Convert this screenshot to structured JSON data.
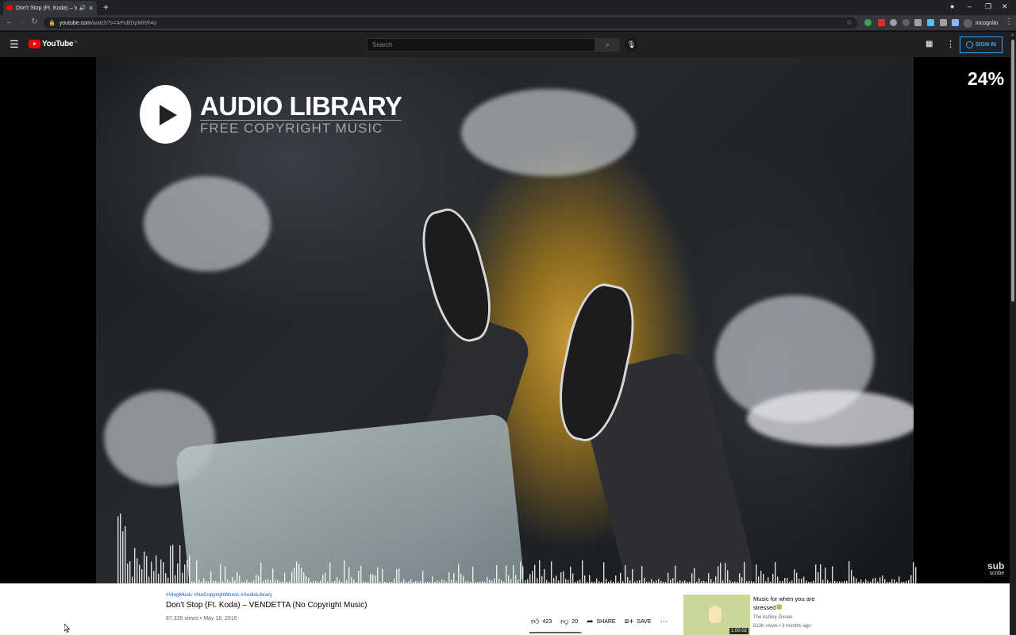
{
  "browser": {
    "tab_title": "Don't Stop (Ft. Koda) – VENDE",
    "url_host": "youtube.com",
    "url_path": "/watch?v=APuBDpMRR4o",
    "profile_label": "Incognito"
  },
  "masthead": {
    "logo_text": "YouTube",
    "logo_country": "RL",
    "search_placeholder": "Search",
    "signin_label": "SIGN IN"
  },
  "player": {
    "overlay_title": "AUDIO LIBRARY",
    "overlay_subtitle": "FREE COPYRIGHT MUSIC",
    "percent_badge": "24%",
    "subscribe_line1": "sub",
    "subscribe_line2": "scribe"
  },
  "video": {
    "hashtags": "#VlogMusic #NoCopyrightMusic #AudioLibrary",
    "title": "Don't Stop (Ft. Koda) – VENDETTA (No Copyright Music)",
    "meta": "87,335 views • May 18, 2016",
    "likes": "423",
    "dislikes": "20",
    "share_label": "SHARE",
    "save_label": "SAVE",
    "like_ratio": 0.955
  },
  "recommendation": {
    "title": "Music for when you are stressed🍀",
    "channel": "The Ashley Zixuan",
    "meta": "613K views • 3 months ago",
    "duration": "1:00:02"
  },
  "colors": {
    "youtube_red": "#ff0000",
    "link_blue": "#065fd4",
    "signin_blue": "#3ea6ff"
  }
}
